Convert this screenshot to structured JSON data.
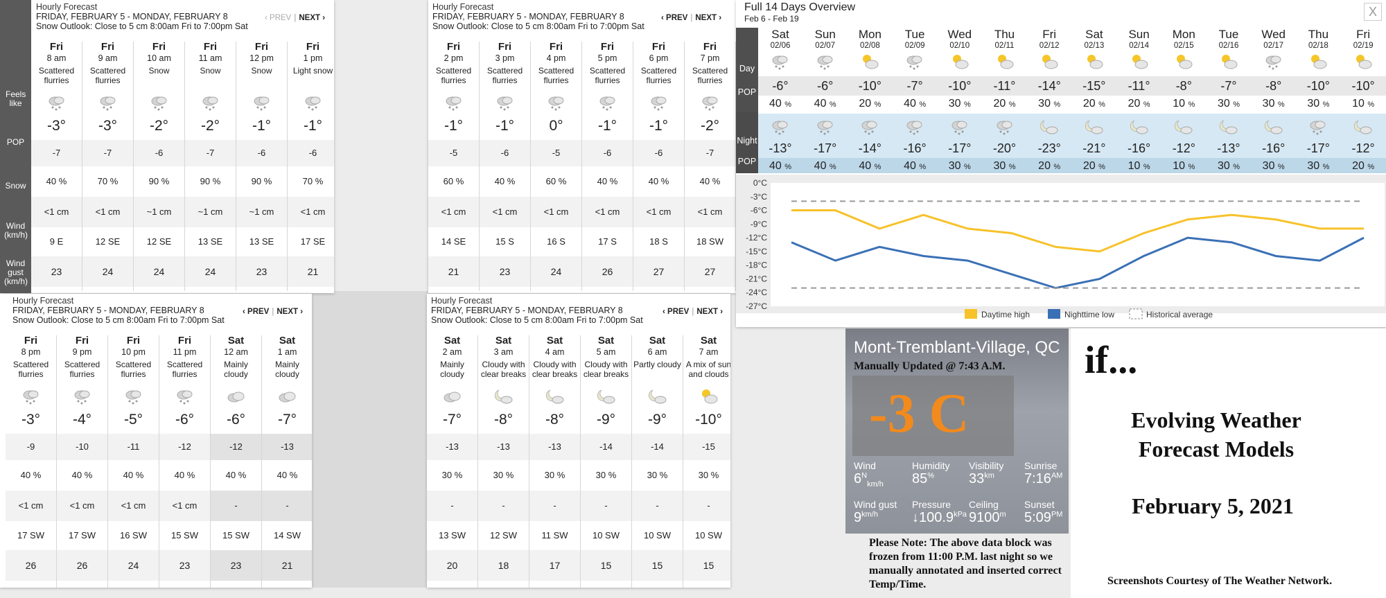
{
  "hourly_panels": [
    {
      "title": "Hourly Forecast",
      "dates": "FRIDAY, FEBRUARY 5 - MONDAY, FEBRUARY 8",
      "outlook": "Snow Outlook: Close to 5 cm 8:00am Fri to 7:00pm Sat",
      "prev": "‹ PREV",
      "next": "NEXT ›",
      "labels": [
        "Feels like",
        "POP",
        "Snow",
        "Wind (km/h)",
        "Wind gust (km/h)"
      ],
      "cols": [
        {
          "day": "Fri",
          "time": "8 am",
          "cond": "Scattered flurries",
          "temp": "-3°",
          "feels": "-7",
          "pop": "40 %",
          "snow": "<1 cm",
          "wind": "9 E",
          "gust": "23"
        },
        {
          "day": "Fri",
          "time": "9 am",
          "cond": "Scattered flurries",
          "temp": "-3°",
          "feels": "-7",
          "pop": "70 %",
          "snow": "<1 cm",
          "wind": "12 SE",
          "gust": "24"
        },
        {
          "day": "Fri",
          "time": "10 am",
          "cond": "Snow",
          "temp": "-2°",
          "feels": "-6",
          "pop": "90 %",
          "snow": "~1 cm",
          "wind": "12 SE",
          "gust": "24"
        },
        {
          "day": "Fri",
          "time": "11 am",
          "cond": "Snow",
          "temp": "-2°",
          "feels": "-7",
          "pop": "90 %",
          "snow": "~1 cm",
          "wind": "13 SE",
          "gust": "24"
        },
        {
          "day": "Fri",
          "time": "12 pm",
          "cond": "Snow",
          "temp": "-1°",
          "feels": "-6",
          "pop": "90 %",
          "snow": "~1 cm",
          "wind": "13 SE",
          "gust": "23"
        },
        {
          "day": "Fri",
          "time": "1 pm",
          "cond": "Light snow",
          "temp": "-1°",
          "feels": "-6",
          "pop": "70 %",
          "snow": "<1 cm",
          "wind": "17 SE",
          "gust": "21"
        }
      ]
    },
    {
      "title": "Hourly Forecast",
      "dates": "FRIDAY, FEBRUARY 5 - MONDAY, FEBRUARY 8",
      "outlook": "Snow Outlook: Close to 5 cm 8:00am Fri to 7:00pm Sat",
      "prev": "‹ PREV",
      "next": "NEXT ›",
      "cols": [
        {
          "day": "Fri",
          "time": "2 pm",
          "cond": "Scattered flurries",
          "temp": "-1°",
          "feels": "-5",
          "pop": "60 %",
          "snow": "<1 cm",
          "wind": "14 SE",
          "gust": "21"
        },
        {
          "day": "Fri",
          "time": "3 pm",
          "cond": "Scattered flurries",
          "temp": "-1°",
          "feels": "-6",
          "pop": "40 %",
          "snow": "<1 cm",
          "wind": "15 S",
          "gust": "23"
        },
        {
          "day": "Fri",
          "time": "4 pm",
          "cond": "Scattered flurries",
          "temp": "0°",
          "feels": "-5",
          "pop": "60 %",
          "snow": "<1 cm",
          "wind": "16 S",
          "gust": "24"
        },
        {
          "day": "Fri",
          "time": "5 pm",
          "cond": "Scattered flurries",
          "temp": "-1°",
          "feels": "-6",
          "pop": "40 %",
          "snow": "<1 cm",
          "wind": "17 S",
          "gust": "26"
        },
        {
          "day": "Fri",
          "time": "6 pm",
          "cond": "Scattered flurries",
          "temp": "-1°",
          "feels": "-6",
          "pop": "40 %",
          "snow": "<1 cm",
          "wind": "18 S",
          "gust": "27"
        },
        {
          "day": "Fri",
          "time": "7 pm",
          "cond": "Scattered flurries",
          "temp": "-2°",
          "feels": "-7",
          "pop": "40 %",
          "snow": "<1 cm",
          "wind": "18 SW",
          "gust": "27"
        }
      ]
    },
    {
      "title": "Hourly Forecast",
      "dates": "FRIDAY, FEBRUARY 5 - MONDAY, FEBRUARY 8",
      "outlook": "Snow Outlook: Close to 5 cm 8:00am Fri to 7:00pm Sat",
      "prev": "‹ PREV",
      "next": "NEXT ›",
      "cols": [
        {
          "day": "Fri",
          "time": "8 pm",
          "cond": "Scattered flurries",
          "temp": "-3°",
          "feels": "-9",
          "pop": "40 %",
          "snow": "<1 cm",
          "wind": "17 SW",
          "gust": "26"
        },
        {
          "day": "Fri",
          "time": "9 pm",
          "cond": "Scattered flurries",
          "temp": "-4°",
          "feels": "-10",
          "pop": "40 %",
          "snow": "<1 cm",
          "wind": "17 SW",
          "gust": "26"
        },
        {
          "day": "Fri",
          "time": "10 pm",
          "cond": "Scattered flurries",
          "temp": "-5°",
          "feels": "-11",
          "pop": "40 %",
          "snow": "<1 cm",
          "wind": "16 SW",
          "gust": "24"
        },
        {
          "day": "Fri",
          "time": "11 pm",
          "cond": "Scattered flurries",
          "temp": "-6°",
          "feels": "-12",
          "pop": "40 %",
          "snow": "<1 cm",
          "wind": "15 SW",
          "gust": "23"
        },
        {
          "day": "Sat",
          "time": "12 am",
          "cond": "Mainly cloudy",
          "temp": "-6°",
          "feels": "-12",
          "pop": "40 %",
          "snow": "-",
          "wind": "15 SW",
          "gust": "23"
        },
        {
          "day": "Sat",
          "time": "1 am",
          "cond": "Mainly cloudy",
          "temp": "-7°",
          "feels": "-13",
          "pop": "40 %",
          "snow": "-",
          "wind": "14 SW",
          "gust": "21"
        }
      ]
    },
    {
      "title": "Hourly Forecast",
      "dates": "FRIDAY, FEBRUARY 5 - MONDAY, FEBRUARY 8",
      "outlook": "Snow Outlook: Close to 5 cm 8:00am Fri to 7:00pm Sat",
      "prev": "‹ PREV",
      "next": "NEXT ›",
      "cols": [
        {
          "day": "Sat",
          "time": "2 am",
          "cond": "Mainly cloudy",
          "temp": "-7°",
          "feels": "-13",
          "pop": "30 %",
          "snow": "-",
          "wind": "13 SW",
          "gust": "20"
        },
        {
          "day": "Sat",
          "time": "3 am",
          "cond": "Cloudy with clear breaks",
          "temp": "-8°",
          "feels": "-13",
          "pop": "30 %",
          "snow": "-",
          "wind": "12 SW",
          "gust": "18"
        },
        {
          "day": "Sat",
          "time": "4 am",
          "cond": "Cloudy with clear breaks",
          "temp": "-8°",
          "feels": "-13",
          "pop": "30 %",
          "snow": "-",
          "wind": "11 SW",
          "gust": "17"
        },
        {
          "day": "Sat",
          "time": "5 am",
          "cond": "Cloudy with clear breaks",
          "temp": "-9°",
          "feels": "-14",
          "pop": "30 %",
          "snow": "-",
          "wind": "10 SW",
          "gust": "15"
        },
        {
          "day": "Sat",
          "time": "6 am",
          "cond": "Partly cloudy",
          "temp": "-9°",
          "feels": "-14",
          "pop": "30 %",
          "snow": "-",
          "wind": "10 SW",
          "gust": "15"
        },
        {
          "day": "Sat",
          "time": "7 am",
          "cond": "A mix of sun and clouds",
          "temp": "-10°",
          "feels": "-15",
          "pop": "30 %",
          "snow": "-",
          "wind": "10 SW",
          "gust": "15"
        }
      ]
    }
  ],
  "fourteen": {
    "title": "Full 14 Days Overview",
    "subtitle": "Feb 6 - Feb 19",
    "close": "X",
    "labels": {
      "day": "Day",
      "pop": "POP",
      "night": "Night"
    },
    "days": [
      {
        "d": "Sat",
        "dt": "02/06",
        "hi": "-6°",
        "pd": "40",
        "lo": "-13°",
        "pn": "40"
      },
      {
        "d": "Sun",
        "dt": "02/07",
        "hi": "-6°",
        "pd": "40",
        "lo": "-17°",
        "pn": "40"
      },
      {
        "d": "Mon",
        "dt": "02/08",
        "hi": "-10°",
        "pd": "20",
        "lo": "-14°",
        "pn": "40"
      },
      {
        "d": "Tue",
        "dt": "02/09",
        "hi": "-7°",
        "pd": "40",
        "lo": "-16°",
        "pn": "40"
      },
      {
        "d": "Wed",
        "dt": "02/10",
        "hi": "-10°",
        "pd": "30",
        "lo": "-17°",
        "pn": "30"
      },
      {
        "d": "Thu",
        "dt": "02/11",
        "hi": "-11°",
        "pd": "20",
        "lo": "-20°",
        "pn": "30"
      },
      {
        "d": "Fri",
        "dt": "02/12",
        "hi": "-14°",
        "pd": "30",
        "lo": "-23°",
        "pn": "20"
      },
      {
        "d": "Sat",
        "dt": "02/13",
        "hi": "-15°",
        "pd": "20",
        "lo": "-21°",
        "pn": "20"
      },
      {
        "d": "Sun",
        "dt": "02/14",
        "hi": "-11°",
        "pd": "20",
        "lo": "-16°",
        "pn": "10"
      },
      {
        "d": "Mon",
        "dt": "02/15",
        "hi": "-8°",
        "pd": "10",
        "lo": "-12°",
        "pn": "10"
      },
      {
        "d": "Tue",
        "dt": "02/16",
        "hi": "-7°",
        "pd": "30",
        "lo": "-13°",
        "pn": "30"
      },
      {
        "d": "Wed",
        "dt": "02/17",
        "hi": "-8°",
        "pd": "30",
        "lo": "-16°",
        "pn": "30"
      },
      {
        "d": "Thu",
        "dt": "02/18",
        "hi": "-10°",
        "pd": "30",
        "lo": "-17°",
        "pn": "30"
      },
      {
        "d": "Fri",
        "dt": "02/19",
        "hi": "-10°",
        "pd": "10",
        "lo": "-12°",
        "pn": "20"
      }
    ],
    "pct": "%"
  },
  "chart_data": {
    "type": "line",
    "x": [
      "02/06",
      "02/07",
      "02/08",
      "02/09",
      "02/10",
      "02/11",
      "02/12",
      "02/13",
      "02/14",
      "02/15",
      "02/16",
      "02/17",
      "02/18",
      "02/19"
    ],
    "series": [
      {
        "name": "Daytime high",
        "color": "#f7c22a",
        "values": [
          -6,
          -6,
          -10,
          -7,
          -10,
          -11,
          -14,
          -15,
          -11,
          -8,
          -7,
          -8,
          -10,
          -10
        ]
      },
      {
        "name": "Nighttime low",
        "color": "#3a70b5",
        "values": [
          -13,
          -17,
          -14,
          -16,
          -17,
          -20,
          -23,
          -21,
          -16,
          -12,
          -13,
          -16,
          -17,
          -12
        ]
      },
      {
        "name": "Historical average",
        "color": "#999999",
        "values": [
          -4,
          -4,
          -4,
          -4,
          -4,
          -4,
          -4,
          -4,
          -4,
          -4,
          -4,
          -4,
          -4,
          -4
        ]
      },
      {
        "name": "Historical average low",
        "color": "#999999",
        "values": [
          -23,
          -23,
          -23,
          -23,
          -23,
          -23,
          -23,
          -23,
          -23,
          -23,
          -23,
          -23,
          -23,
          -23
        ]
      }
    ],
    "ylim": [
      -27,
      0
    ],
    "yticks": [
      "0°C",
      "-3°C",
      "-6°C",
      "-9°C",
      "-12°C",
      "-15°C",
      "-18°C",
      "-21°C",
      "-24°C",
      "-27°C"
    ],
    "legend": [
      "Daytime high",
      "Nighttime low",
      "Historical average"
    ],
    "legend_position": "bottom-center"
  },
  "station": {
    "city": "Mont-Tremblant-Village, QC",
    "updated": "Manually Updated @ 7:43 A.M.",
    "temp": "-3 C",
    "wind_k": "Wind",
    "wind_v": "6",
    "wind_dir": "N",
    "wind_u": "km/h",
    "hum_k": "Humidity",
    "hum_v": "85",
    "hum_u": "%",
    "vis_k": "Visibility",
    "vis_v": "33",
    "vis_u": "km",
    "sun_k": "Sunrise",
    "sun_v": "7:16",
    "sun_u": "AM",
    "gust_k": "Wind gust",
    "gust_v": "9",
    "gust_u": "km/h",
    "pres_k": "Pressure",
    "pres_v": "↓100.9",
    "pres_u": "kPa",
    "ceil_k": "Ceiling",
    "ceil_v": "9100",
    "ceil_u": "m",
    "set_k": "Sunset",
    "set_v": "5:09",
    "set_u": "PM"
  },
  "note": "Please Note: The above data block was frozen from 11:00 P.M. last night so we manually annotated and inserted correct Temp/Time.",
  "slide": {
    "if": "if...",
    "title1": "Evolving Weather",
    "title2": "Forecast Models",
    "date": "February 5, 2021",
    "credit": "Screenshots Courtesy of The Weather Network."
  }
}
